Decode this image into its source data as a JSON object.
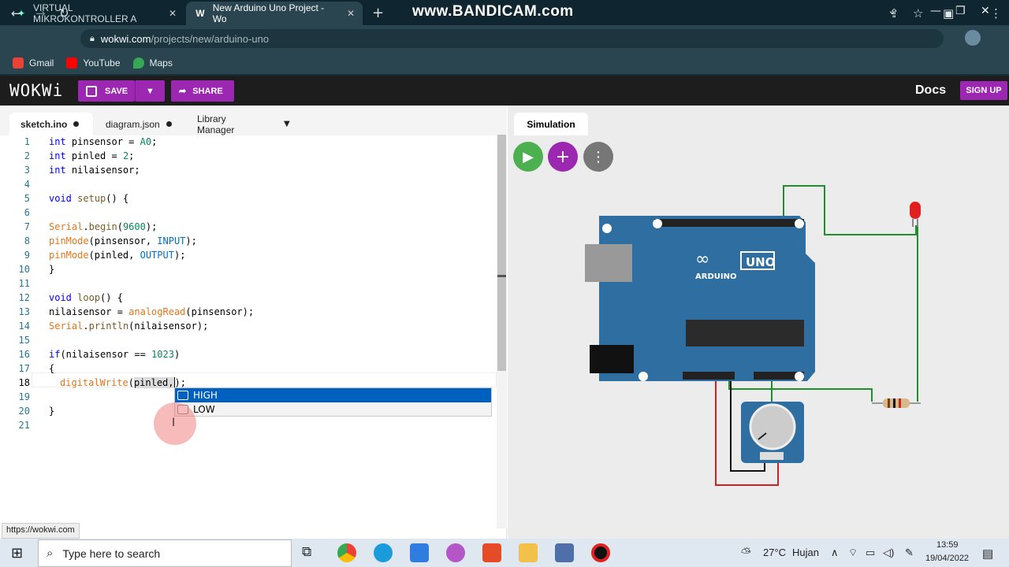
{
  "browser": {
    "tabs": [
      {
        "label": "VIRTUAL MIKROKONTROLLER A",
        "icon": "wokwi-favicon-icon"
      },
      {
        "label": "New Arduino Uno Project - Wo",
        "icon": "wokwi-w-icon"
      }
    ],
    "watermark": "www.BANDICAM.com",
    "url_host": "wokwi.com",
    "url_path": "/projects/new/arduino-uno",
    "bookmarks": [
      "Gmail",
      "YouTube",
      "Maps"
    ]
  },
  "wokwi": {
    "logo": "WOKWi",
    "save_label": "SAVE",
    "share_label": "SHARE",
    "docs_label": "Docs",
    "signup_label": "SIGN UP"
  },
  "editor": {
    "tabs": [
      {
        "label": "sketch.ino"
      },
      {
        "label": "diagram.json"
      },
      {
        "label": "Library Manager"
      }
    ],
    "suggestions": [
      "HIGH",
      "LOW"
    ],
    "status_url": "https://wokwi.com"
  },
  "simulation": {
    "tab_label": "Simulation",
    "board_brand": "ARDUINO",
    "board_model": "UNO"
  },
  "taskbar": {
    "search_placeholder": "Type here to search",
    "temperature": "27°C",
    "weather": "Hujan",
    "time": "13:59",
    "date": "19/04/2022"
  },
  "colors": {
    "accent": "#9c27b0",
    "run_green": "#4caf50",
    "board_blue": "#2e6ea1",
    "selection_blue": "#0060c0"
  }
}
